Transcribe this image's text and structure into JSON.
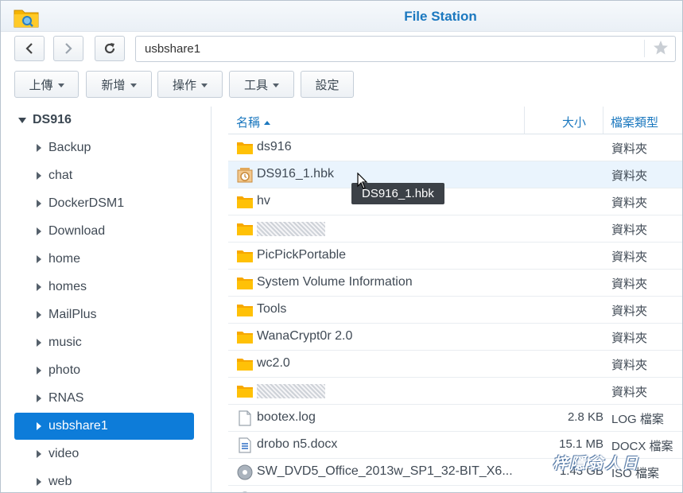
{
  "app": {
    "title": "File Station",
    "accent": "#1b78bf",
    "selected_bg": "#0d7cd9"
  },
  "nav": {
    "back_icon": "chevron-left-icon",
    "forward_icon": "chevron-right-icon",
    "refresh_icon": "refresh-icon",
    "path": "usbshare1",
    "bookmark_icon": "star-icon"
  },
  "toolbar": {
    "upload": "上傳",
    "create": "新增",
    "action": "操作",
    "tools": "工具",
    "settings": "設定"
  },
  "sidebar": {
    "root": "DS916",
    "items": [
      {
        "label": "Backup"
      },
      {
        "label": "chat"
      },
      {
        "label": "DockerDSM1"
      },
      {
        "label": "Download"
      },
      {
        "label": "home"
      },
      {
        "label": "homes"
      },
      {
        "label": "MailPlus"
      },
      {
        "label": "music"
      },
      {
        "label": "photo"
      },
      {
        "label": "RNAS"
      },
      {
        "label": "usbshare1"
      },
      {
        "label": "video"
      },
      {
        "label": "web"
      }
    ],
    "selected": "usbshare1"
  },
  "columns": {
    "name": "名稱",
    "size": "大小",
    "type": "檔案類型"
  },
  "files": [
    {
      "name": "ds916",
      "size": "",
      "type": "資料夾",
      "icon": "folder-icon"
    },
    {
      "name": "DS916_1.hbk",
      "size": "",
      "type": "資料夾",
      "icon": "backup-icon"
    },
    {
      "name": "hv",
      "size": "",
      "type": "資料夾",
      "icon": "folder-icon"
    },
    {
      "name": "",
      "size": "",
      "type": "資料夾",
      "icon": "folder-icon"
    },
    {
      "name": "PicPickPortable",
      "size": "",
      "type": "資料夾",
      "icon": "folder-icon"
    },
    {
      "name": "System Volume Information",
      "size": "",
      "type": "資料夾",
      "icon": "folder-icon"
    },
    {
      "name": "Tools",
      "size": "",
      "type": "資料夾",
      "icon": "folder-icon"
    },
    {
      "name": "WanaCrypt0r 2.0",
      "size": "",
      "type": "資料夾",
      "icon": "folder-icon"
    },
    {
      "name": "wc2.0",
      "size": "",
      "type": "資料夾",
      "icon": "folder-icon"
    },
    {
      "name": "",
      "size": "",
      "type": "資料夾",
      "icon": "folder-icon"
    },
    {
      "name": "bootex.log",
      "size": "2.8 KB",
      "type": "LOG 檔案",
      "icon": "document-icon"
    },
    {
      "name": "drobo n5.docx",
      "size": "15.1 MB",
      "type": "DOCX 檔案",
      "icon": "word-document-icon"
    },
    {
      "name": "SW_DVD5_Office_2013w_SP1_32-BIT_X6...",
      "size": "1.43 GB",
      "type": "ISO 檔案",
      "icon": "disc-image-icon"
    }
  ],
  "tooltip": "DS916_1.hbk",
  "watermark": "梓隱翁人日"
}
